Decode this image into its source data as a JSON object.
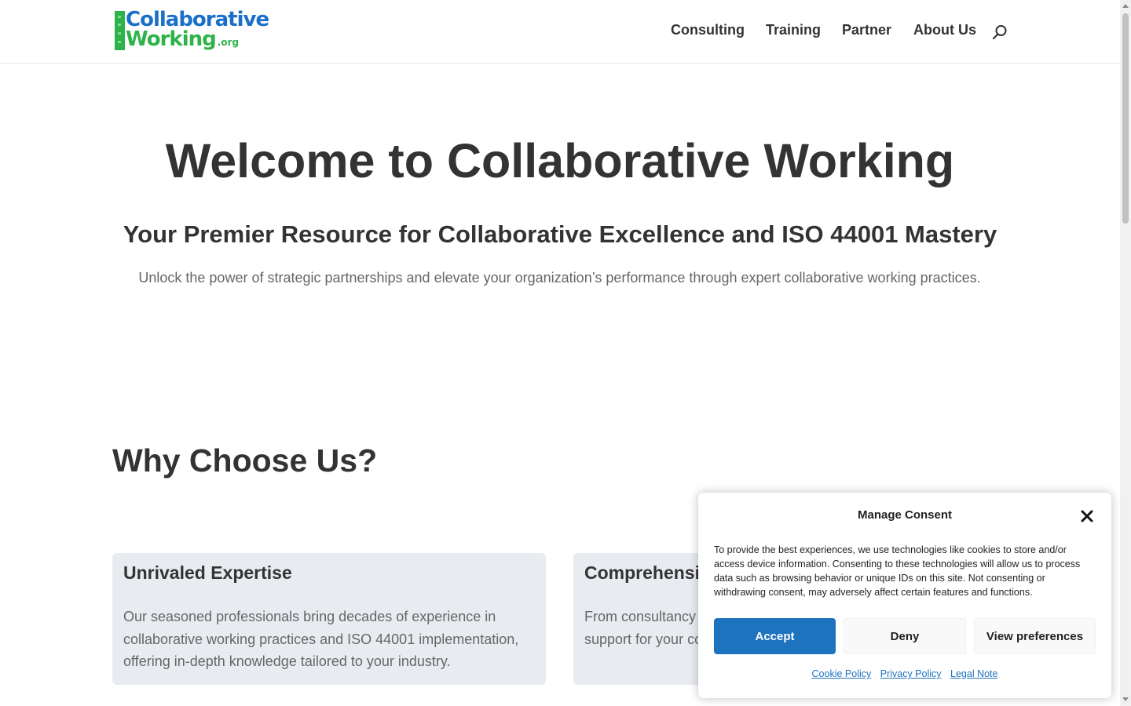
{
  "logo": {
    "line1": "Collaborative",
    "line2": "Working",
    "suffix": ".org"
  },
  "nav": {
    "items": [
      {
        "label": "Consulting"
      },
      {
        "label": "Training"
      },
      {
        "label": "Partner"
      },
      {
        "label": "About Us"
      }
    ],
    "search_icon": "search-icon"
  },
  "hero": {
    "title": "Welcome to Collaborative Working",
    "subtitle": "Your Premier Resource for Collaborative Excellence and ISO 44001 Mastery",
    "text": "Unlock the power of strategic partnerships and elevate your organization’s performance through expert collaborative working practices."
  },
  "why": {
    "title": "Why Choose Us?",
    "cards": [
      {
        "title": "Unrivaled Expertise",
        "text": "Our seasoned professionals bring decades of experience in collaborative working practices and ISO 44001 implementation, offering in-depth knowledge tailored to your industry."
      },
      {
        "title": "Comprehensive Solutions",
        "text": "From consultancy to training and certification, we offer end-to-end support for your collaborative working journey."
      }
    ]
  },
  "consent": {
    "title": "Manage Consent",
    "text": "To provide the best experiences, we use technologies like cookies to store and/or access device information. Consenting to these technologies will allow us to process data such as browsing behavior or unique IDs on this site. Not consenting or withdrawing consent, may adversely affect certain features and functions.",
    "accept_label": "Accept",
    "deny_label": "Deny",
    "prefs_label": "View preferences",
    "links": [
      "Cookie Policy",
      "Privacy Policy",
      "Legal Note"
    ]
  },
  "colors": {
    "brand_blue": "#1a6fc9",
    "brand_green": "#2db34a",
    "accent": "#1e73be",
    "card_bg": "#e8ecf1"
  }
}
